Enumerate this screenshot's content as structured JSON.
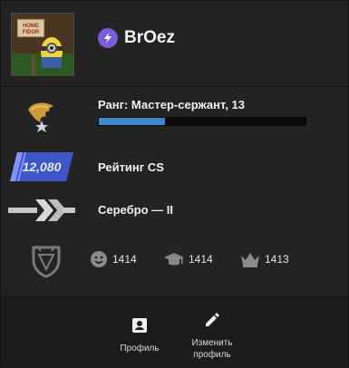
{
  "profile": {
    "username": "BrOez",
    "avatar_sign_text": "HOME\nFIDOR",
    "prime_icon": "prime-lightning-icon"
  },
  "rank": {
    "label": "Ранг: Мастер-сержант, 13",
    "xp_progress": 0.32,
    "icon": "eagle-star-icon"
  },
  "cs_rating": {
    "value": "12,080",
    "label": "Рейтинг CS",
    "badge_color": "#3f56c8"
  },
  "skill_group": {
    "label": "Серебро — II",
    "icon": "silver-chevrons-icon"
  },
  "stats": {
    "emblem_icon": "service-medal-icon",
    "friendly": {
      "icon": "smile-icon",
      "value": "1414"
    },
    "teacher": {
      "icon": "graduation-cap-icon",
      "value": "1414"
    },
    "leader": {
      "icon": "crown-icon",
      "value": "1413"
    }
  },
  "actions": {
    "profile": {
      "label": "Профиль",
      "icon": "profile-card-icon"
    },
    "edit": {
      "label": "Изменить\nпрофиль",
      "icon": "pencil-icon"
    }
  },
  "colors": {
    "accent": "#3e88cc",
    "prime": "#7d5bd8",
    "background": "#232323"
  }
}
